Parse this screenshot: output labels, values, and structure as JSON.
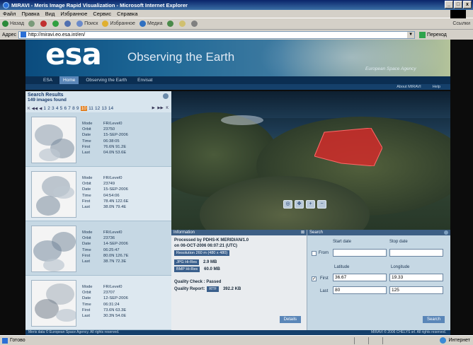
{
  "window": {
    "title": "MIRAVI - Meris Image Rapid Visualization - Microsoft Internet Explorer",
    "controls": [
      "_",
      "□",
      "x"
    ]
  },
  "menu": [
    "Файл",
    "Правка",
    "Вид",
    "Избранное",
    "Сервис",
    "Справка"
  ],
  "toolbar": {
    "back": "Назад",
    "search": "Поиск",
    "favorites": "Избранное",
    "media": "Медиа",
    "links": "Ссылки"
  },
  "address": {
    "label": "Адрес",
    "url": "http://miravi.eo.esa.int/en/",
    "go": "Переход"
  },
  "banner": {
    "logo": "esa",
    "tagline": "Observing the Earth",
    "agency": "European Space Agency"
  },
  "nav": [
    "ESA",
    "Home",
    "Observing the Earth",
    "Envisat"
  ],
  "nav_active": "Home",
  "subnav": [
    "About MIRAVI",
    "Help"
  ],
  "results": {
    "title": "Search Results",
    "count": "149 images found",
    "pager_prev": [
      "K",
      "◀◀",
      "◀"
    ],
    "pages": [
      "1",
      "2",
      "3",
      "4",
      "5",
      "6",
      "7",
      "8",
      "9",
      "10",
      "11",
      "12",
      "13",
      "14"
    ],
    "current_page": "10",
    "pager_next": [
      "▶",
      "▶▶",
      "K"
    ],
    "items": [
      {
        "mode": "FR/Level0",
        "orbit": "23750",
        "date": "15-SEP-2006",
        "time": "06:38:05",
        "first": "76.6N 91.2E",
        "last": "04.0N 53.6E"
      },
      {
        "mode": "FR/Level0",
        "orbit": "23749",
        "date": "15-SEP-2006",
        "time": "04:54:06",
        "first": "78.4N 122.6E",
        "last": "38.0N 79.4E"
      },
      {
        "mode": "FR/Level0",
        "orbit": "23736",
        "date": "14-SEP-2006",
        "time": "06:25:47",
        "first": "80.0N 126.7E",
        "last": "38.7N 72.3E"
      },
      {
        "mode": "FR/Level0",
        "orbit": "23707",
        "date": "12-SEP-2006",
        "time": "06:31:24",
        "first": "73.6N 63.3E",
        "last": "30.3N 54.0E"
      }
    ],
    "labels": {
      "mode": "Mode",
      "orbit": "Orbit",
      "date": "Date",
      "time": "Time",
      "first": "First",
      "last": "Last"
    }
  },
  "info": {
    "title": "Information",
    "line1": "Processed by PDHS-K MERIDIAN/1.0",
    "line2": "on 06-OCT-2006 06:07:21 (UTC)",
    "resolution": "Resolution 260 m (480 x 480)",
    "jpg_label": "JPG Hi-Res",
    "jpg_size": "2.9 MB",
    "bmp_label": "BMP Hi-Res",
    "bmp_size": "60.0 MB",
    "quality_check": "Quality Check : Passed",
    "quality_report_label": "Quality Report:",
    "quality_report_btn": "RTF",
    "quality_report_size": "392.2 KB",
    "details": "Details"
  },
  "search": {
    "title": "Search",
    "start_date": "Start date",
    "stop_date": "Stop date",
    "from": "From",
    "latitude": "Latitude",
    "longitude": "Longitude",
    "first": "First",
    "first_lat": "36.67",
    "first_lon": "19.33",
    "last": "Last",
    "last_lat": "80",
    "last_lon": "125",
    "search_btn": "Search"
  },
  "footer": {
    "left": "Meris data © European Space Agency. All rights reserved.",
    "right": "MIRAVI © 2006 CHELYS srl. All rights reserved."
  },
  "status": {
    "left": "Готово",
    "zone": "Интернет"
  },
  "colors": {
    "footprint": "#d62a2a",
    "current_page": "#e27f20",
    "panel_header": "#3d5f85"
  }
}
